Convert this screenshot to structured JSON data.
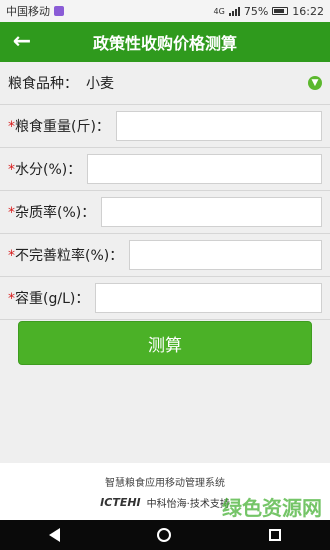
{
  "status_bar": {
    "carrier": "中国移动",
    "battery": "75%",
    "time": "16:22",
    "network": "4G"
  },
  "header": {
    "title": "政策性收购价格测算"
  },
  "form": {
    "grain_type": {
      "label": "粮食品种：",
      "value": "小麦"
    },
    "weight": {
      "required": "*",
      "label": "粮食重量(斤)：",
      "value": ""
    },
    "moisture": {
      "required": "*",
      "label": "水分(%)：",
      "value": ""
    },
    "impurity": {
      "required": "*",
      "label": "杂质率(%)：",
      "value": ""
    },
    "imperfect": {
      "required": "*",
      "label": "不完善粒率(%)：",
      "value": ""
    },
    "bulk_density": {
      "required": "*",
      "label": "容重(g/L)：",
      "value": ""
    }
  },
  "calc_button_label": "测算",
  "footer": {
    "title": "智慧粮食应用移动管理系统",
    "logo": "ICTEHI",
    "support": "中科怡海·技术支持"
  },
  "watermark": "绿色资源网",
  "icons": {
    "back": "arrow-left-icon",
    "dropdown": "chevron-down-circle-icon"
  },
  "colors": {
    "header": "#2f9a1d",
    "button": "#4bb127",
    "required": "#d81d1d"
  }
}
